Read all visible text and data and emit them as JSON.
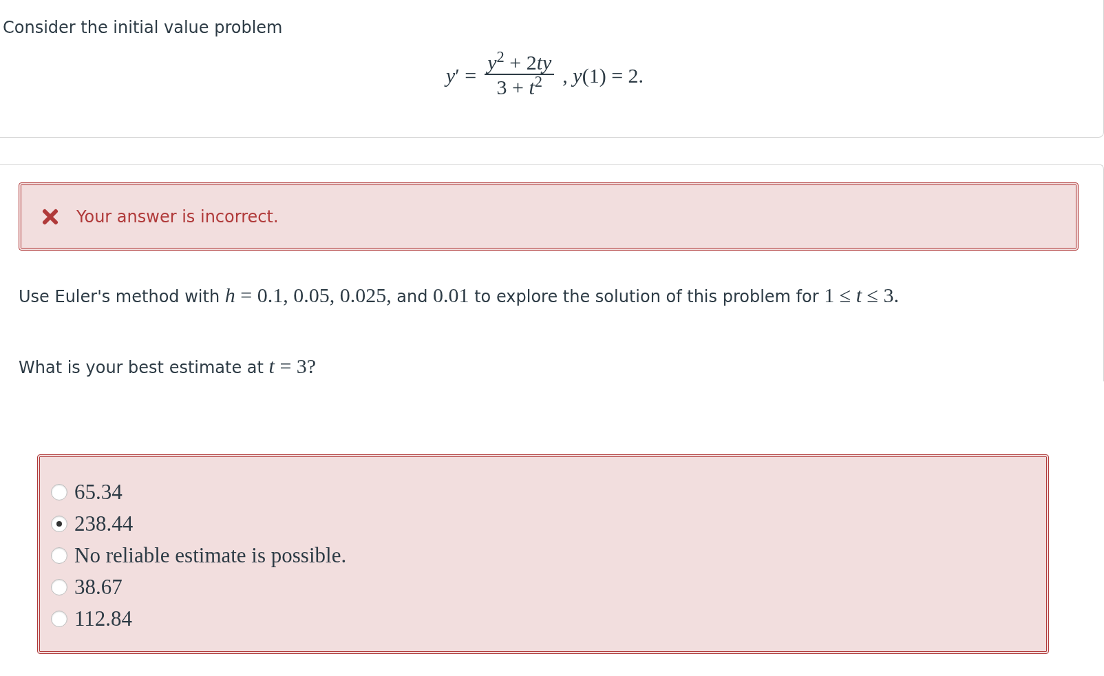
{
  "intro": "Consider the initial value problem",
  "equation": {
    "lhs": "*y*′ =",
    "numerator": [
      {
        "kind": "italic",
        "text": "y"
      },
      {
        "kind": "sup",
        "text": "2"
      },
      {
        "kind": "roman",
        "text": " + 2"
      },
      {
        "kind": "italic",
        "text": "ty"
      }
    ],
    "denominator": "3 + *t*$^{2}$",
    "condition": ",  *y*(1) = 2."
  },
  "feedback": {
    "kind": "incorrect",
    "message": "Your answer is incorrect."
  },
  "instruction": [
    {
      "kind": "text",
      "text": "Use Euler's method with "
    },
    {
      "kind": "math",
      "text": "*h* = 0.1, 0.05, 0.025,"
    },
    {
      "kind": "text",
      "text": " and "
    },
    {
      "kind": "math",
      "text": "0.01"
    },
    {
      "kind": "text",
      "text": " to explore the solution of this problem for "
    },
    {
      "kind": "math",
      "text": "1 ≤ *t* ≤ 3."
    }
  ],
  "question": [
    {
      "kind": "text",
      "text": "What is your best estimate at "
    },
    {
      "kind": "math",
      "text": "*t* = 3?"
    }
  ],
  "answers": {
    "options": [
      {
        "label": "65.34",
        "selected": false
      },
      {
        "label": "238.44",
        "selected": true
      },
      {
        "label": "No reliable estimate is possible.",
        "selected": false
      },
      {
        "label": "38.67",
        "selected": false
      },
      {
        "label": "112.84",
        "selected": false
      }
    ]
  }
}
